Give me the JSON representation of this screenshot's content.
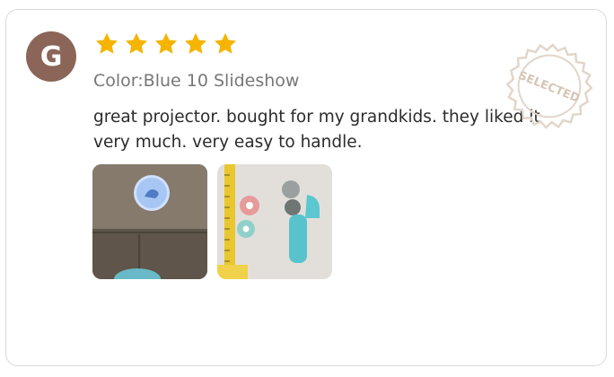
{
  "review": {
    "avatar_initial": "G",
    "rating": 5,
    "variant": "Color:Blue 10 Slideshow",
    "text": "great projector. bought for my grandkids. they liked it very much. very easy to handle.",
    "badge_text": "SELECTED"
  },
  "photos": [
    {
      "name": "review-photo-1",
      "alt": "projection on wall"
    },
    {
      "name": "review-photo-2",
      "alt": "projector with slide reels"
    }
  ],
  "colors": {
    "avatar": "#8a6558",
    "star": "#f5b400",
    "variant_text": "#777777",
    "body_text": "#2b2b2b",
    "stamp": "#c9b6a5"
  },
  "icons": {
    "star": "star-icon",
    "badge": "selected-stamp-icon"
  }
}
